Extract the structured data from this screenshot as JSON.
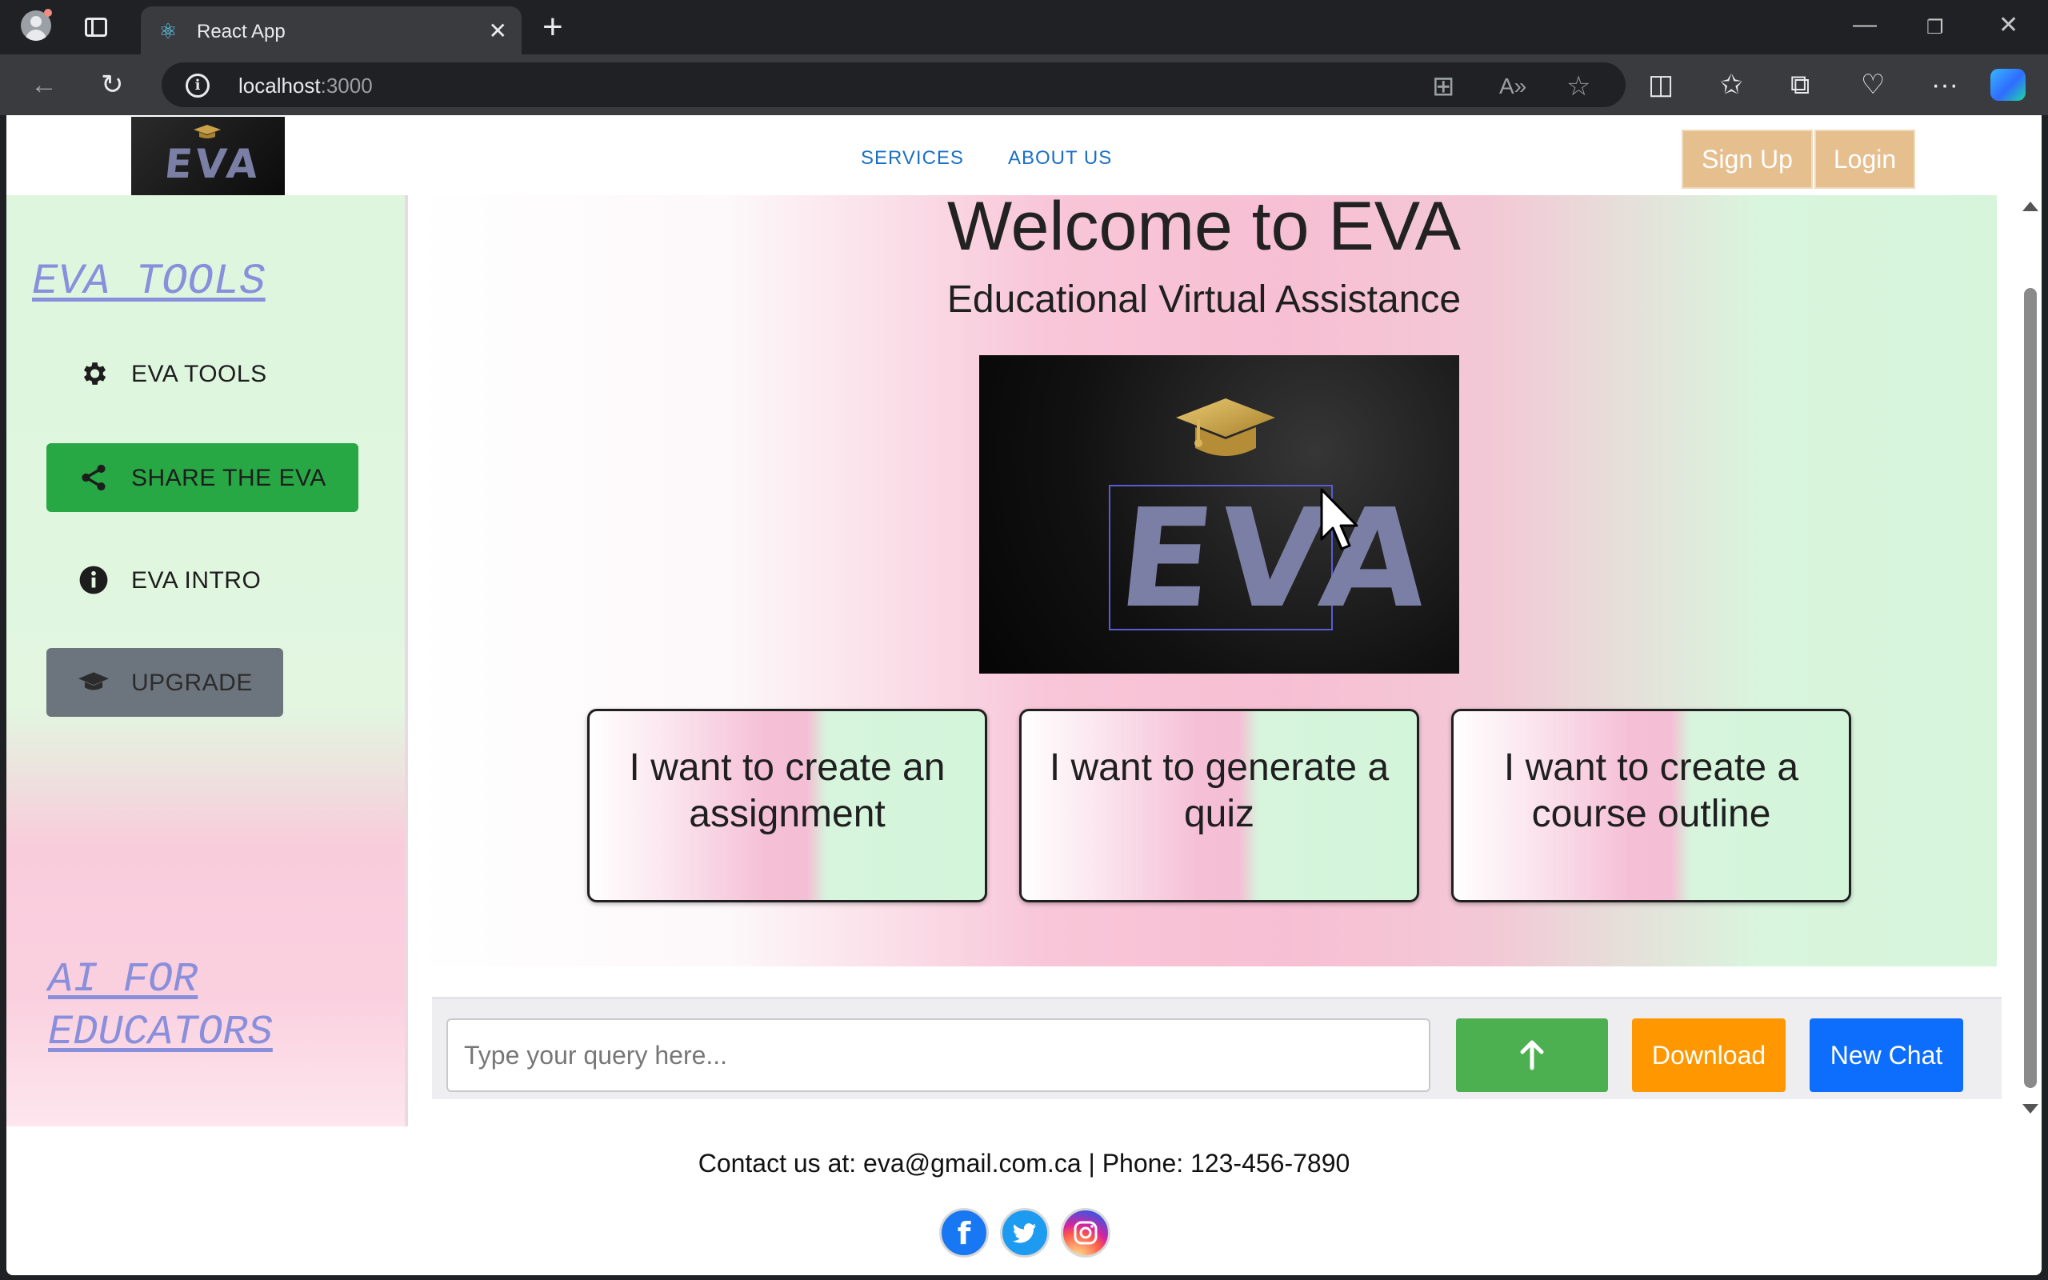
{
  "browser": {
    "tab_title": "React App",
    "tab_favicon": "react-icon",
    "url_host": "localhost",
    "url_port": ":3000"
  },
  "header": {
    "logo_text": "EVA",
    "nav": [
      {
        "label": "SERVICES"
      },
      {
        "label": "ABOUT US"
      }
    ],
    "signup_label": "Sign Up",
    "login_label": "Login"
  },
  "sidebar": {
    "title": "EVA TOOLS",
    "items": [
      {
        "label": "EVA TOOLS",
        "icon": "gear-icon"
      },
      {
        "label": "SHARE THE EVA",
        "icon": "share-icon"
      },
      {
        "label": "EVA INTRO",
        "icon": "info-icon"
      },
      {
        "label": "UPGRADE",
        "icon": "graduation-cap-icon"
      }
    ],
    "footer_line1": "AI FOR",
    "footer_line2": "EDUCATORS"
  },
  "main": {
    "title": "Welcome to EVA",
    "subtitle": "Educational Virtual Assistance",
    "hero_text": "EVA",
    "cards": [
      {
        "label": "I want to create an assignment"
      },
      {
        "label": "I want to generate a quiz"
      },
      {
        "label": "I want to create a course outline"
      }
    ]
  },
  "chat": {
    "placeholder": "Type your query here...",
    "send_icon": "arrow-up-icon",
    "download_label": "Download",
    "new_chat_label": "New Chat"
  },
  "footer": {
    "contact": "Contact us at: eva@gmail.com.ca | Phone: 123-456-7890",
    "social": [
      "facebook-icon",
      "twitter-icon",
      "instagram-icon"
    ]
  },
  "colors": {
    "share_green": "#28a745",
    "upgrade_gray": "#6c757d",
    "auth_tan": "#e6bf8f",
    "send_green": "#4caf50",
    "download_orange": "#ff9800",
    "new_chat_blue": "#0d6efd"
  }
}
